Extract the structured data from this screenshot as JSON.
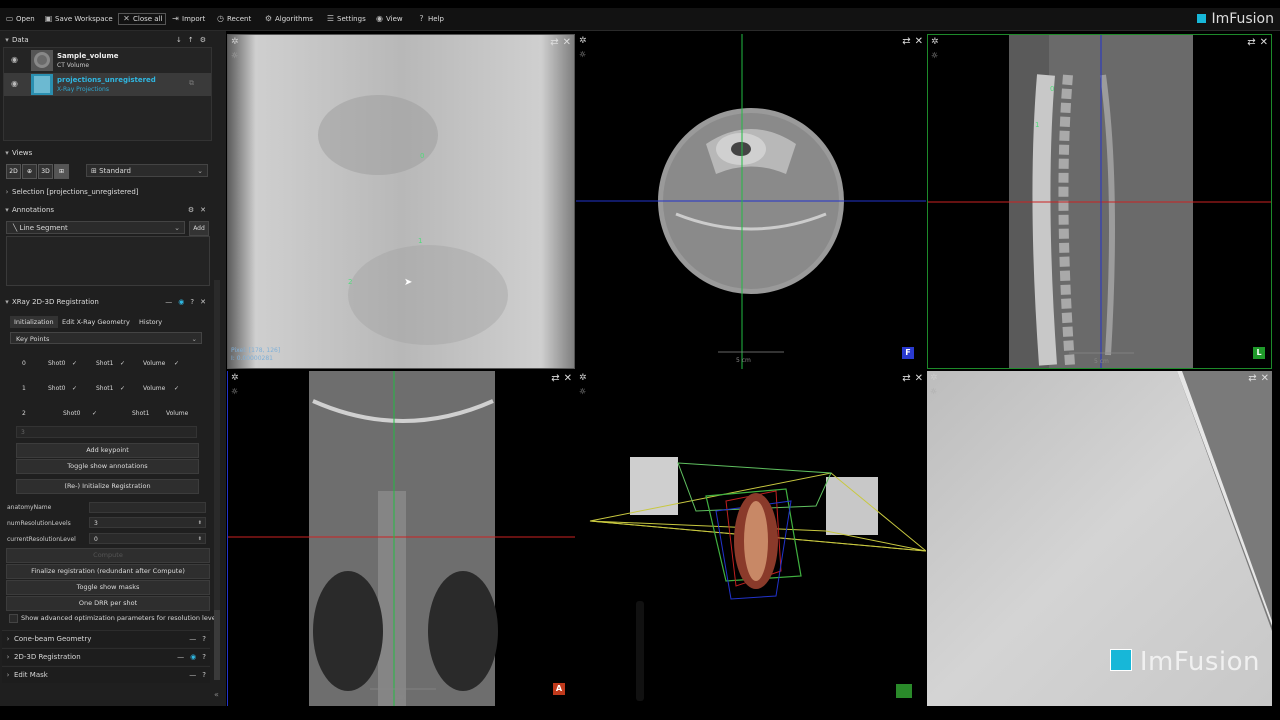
{
  "toolbar": {
    "open": "Open",
    "save_workspace": "Save Workspace",
    "close_all": "Close all",
    "import": "Import",
    "recent": "Recent",
    "algorithms": "Algorithms",
    "settings": "Settings",
    "view": "View",
    "help": "Help",
    "logo": "ImFusion"
  },
  "data_panel": {
    "title": "Data",
    "items": [
      {
        "name": "Sample_volume",
        "type": "CT Volume"
      },
      {
        "name": "projections_unregistered",
        "type": "X-Ray Projections"
      }
    ]
  },
  "views_panel": {
    "title": "Views",
    "buttons": [
      "2D",
      "",
      "3D",
      ""
    ],
    "layout_select": "Standard"
  },
  "selection_panel": {
    "title": "Selection [projections_unregistered]"
  },
  "annotations_panel": {
    "title": "Annotations",
    "type_select": "Line Segment",
    "add_label": "Add"
  },
  "registration_panel": {
    "title": "XRay 2D-3D Registration",
    "tabs": [
      "Initialization",
      "Edit X-Ray Geometry",
      "History"
    ],
    "mode_select": "Key Points",
    "keypoints": [
      {
        "index": "0",
        "a": "Shot0",
        "b": "Shot1",
        "c": "Volume"
      },
      {
        "index": "1",
        "a": "Shot0",
        "b": "Shot1",
        "c": "Volume"
      },
      {
        "index": "2",
        "a": "Shot0",
        "b": "Shot1",
        "c": "Volume"
      }
    ],
    "kp_input": "3",
    "add_keypoint": "Add keypoint",
    "toggle_annotations": "Toggle show annotations",
    "reinit": "(Re-) Initialize Registration",
    "props": [
      {
        "label": "anatomyName",
        "value": ""
      },
      {
        "label": "numResolutionLevels",
        "value": "3"
      },
      {
        "label": "currentResolutionLevel",
        "value": "0"
      }
    ],
    "compute": "Compute",
    "finalize": "Finalize registration (redundant after Compute)",
    "toggle_masks": "Toggle show masks",
    "one_drr": "One DRR per shot",
    "show_advanced": "Show advanced optimization parameters for resolution level"
  },
  "collapsed_panels": [
    "Cone-beam Geometry",
    "2D-3D Registration",
    "Edit Mask"
  ],
  "viewports": {
    "xray_top": {
      "pixel_info": "Pixel: [178, 126]",
      "value_info": "I: 0.00000281",
      "keypoints": [
        "0",
        "1",
        "2"
      ]
    },
    "axial": {
      "ruler": "5 cm",
      "orientation": "F",
      "orientation_color": "#2a3ad0"
    },
    "sagittal": {
      "ruler": "5 cm",
      "orientation": "L",
      "orientation_color": "#1f9a2a",
      "keypoints": [
        "0",
        "1"
      ]
    },
    "coronal": {
      "ruler": "5 cm",
      "orientation": "A",
      "orientation_color": "#c0391b"
    },
    "render3d": {},
    "xray_bottom": {}
  },
  "brand": {
    "logo": "ImFusion",
    "accent": "#17b7d8"
  }
}
